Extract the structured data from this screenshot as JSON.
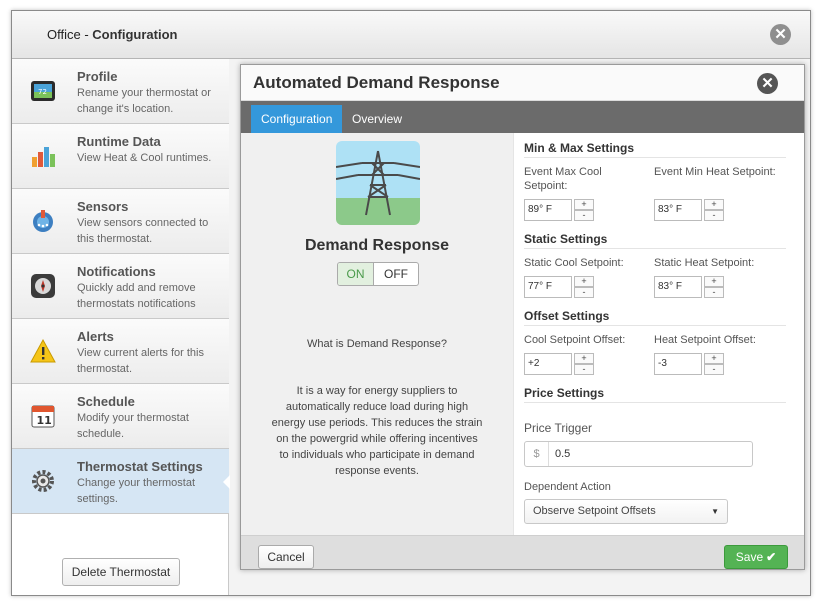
{
  "window": {
    "title_prefix": "Office - ",
    "title_main": "Configuration",
    "close_glyph": "✕"
  },
  "sidebar": {
    "items": [
      {
        "title": "Profile",
        "desc": "Rename your thermostat or change it's location.",
        "icon": "thermostat-display-icon"
      },
      {
        "title": "Runtime Data",
        "desc": "View Heat & Cool runtimes.",
        "icon": "bar-chart-icon"
      },
      {
        "title": "Sensors",
        "desc": "View sensors connected to this thermostat.",
        "icon": "sensor-icon"
      },
      {
        "title": "Notifications",
        "desc": "Quickly add and remove thermostats notifications",
        "icon": "notification-bell-icon"
      },
      {
        "title": "Alerts",
        "desc": "View current alerts for this thermostat.",
        "icon": "warning-icon"
      },
      {
        "title": "Schedule",
        "desc": "Modify your thermostat schedule.",
        "icon": "calendar-icon"
      },
      {
        "title": "Thermostat Settings",
        "desc": "Change your thermostat settings.",
        "icon": "gear-icon"
      }
    ],
    "active_index": 6,
    "calendar_day": "11",
    "delete_label": "Delete Thermostat"
  },
  "dialog": {
    "title": "Automated Demand Response",
    "close_glyph": "✕",
    "tabs": [
      {
        "label": "Configuration",
        "active": true
      },
      {
        "label": "Overview",
        "active": false
      }
    ],
    "left": {
      "icon": "power-tower-icon",
      "heading": "Demand Response",
      "toggle_on": "ON",
      "toggle_off": "OFF",
      "toggle_state": "ON",
      "question": "What is Demand Response?",
      "description": "It is a way for energy suppliers to automatically reduce load during high energy use periods. This reduces the strain on the powergrid while offering incentives to individuals who participate in demand response events."
    },
    "right": {
      "minmax": {
        "title": "Min & Max Settings",
        "cool_label": "Event Max Cool Setpoint:",
        "cool_value": "89° F",
        "heat_label": "Event Min Heat Setpoint:",
        "heat_value": "83° F"
      },
      "static": {
        "title": "Static Settings",
        "cool_label": "Static Cool Setpoint:",
        "cool_value": "77° F",
        "heat_label": "Static Heat Setpoint:",
        "heat_value": "83° F"
      },
      "offset": {
        "title": "Offset Settings",
        "cool_label": "Cool Setpoint Offset:",
        "cool_value": "+2",
        "heat_label": "Heat Setpoint Offset:",
        "heat_value": "-3"
      },
      "price": {
        "title": "Price Settings",
        "trigger_label": "Price Trigger",
        "currency": "$",
        "trigger_value": "0.5",
        "action_label": "Dependent Action",
        "action_value": "Observe Setpoint Offsets"
      },
      "stepper_up": "+",
      "stepper_down": "-"
    },
    "footer": {
      "cancel_label": "Cancel",
      "save_label": "Save",
      "save_check": "✔"
    }
  },
  "colors": {
    "tab_active": "#3498db",
    "save_green": "#54b354",
    "selected_sidebar": "#d6e6f4"
  }
}
